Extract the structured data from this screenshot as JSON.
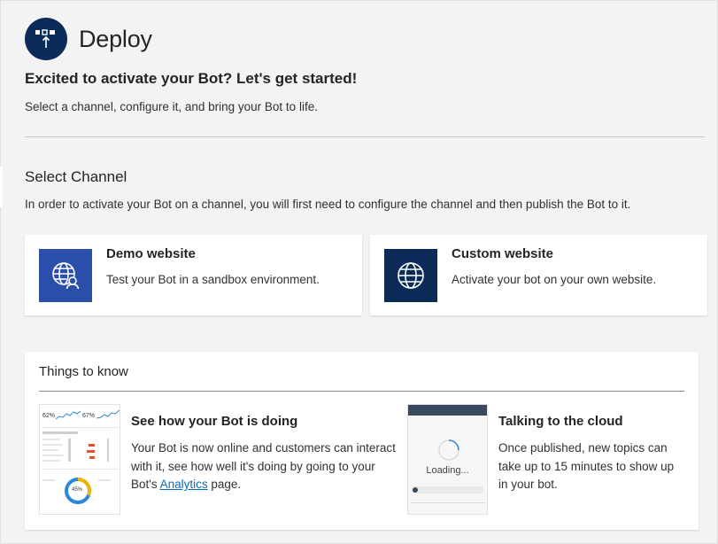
{
  "header": {
    "title": "Deploy",
    "icon": "deploy-icon"
  },
  "intro": {
    "subtitle": "Excited to activate your Bot? Let's get started!",
    "description": "Select a channel, configure it, and bring your Bot to life."
  },
  "select_channel": {
    "title": "Select Channel",
    "description": "In order to activate your Bot on a channel, you will first need to configure the channel and then publish the Bot to it.",
    "cards": [
      {
        "title": "Demo website",
        "text": "Test your Bot in a sandbox environment.",
        "icon": "globe-person-icon",
        "color": "#2c4eab"
      },
      {
        "title": "Custom website",
        "text": "Activate your bot on your own website.",
        "icon": "globe-icon",
        "color": "#0b2c59"
      }
    ]
  },
  "things_to_know": {
    "title": "Things to know",
    "items": [
      {
        "title": "See how your Bot is doing",
        "text_before": "Your Bot is now online and customers can interact with it, see how well it's doing by going to your Bot's ",
        "link": "Analytics",
        "text_after": " page.",
        "thumbnail": {
          "stat_1": "62%",
          "stat_2": "67%",
          "donut_label": "45%"
        }
      },
      {
        "title": "Talking to the cloud",
        "text": "Once published, new topics can take up to 15 minutes to show up in your bot.",
        "thumbnail": {
          "loading_label": "Loading..."
        }
      }
    ]
  },
  "colors": {
    "brand_dark": "#0b2c59",
    "brand_blue": "#2c4eab",
    "link": "#0f6cbd",
    "background": "#f3f3f3"
  }
}
